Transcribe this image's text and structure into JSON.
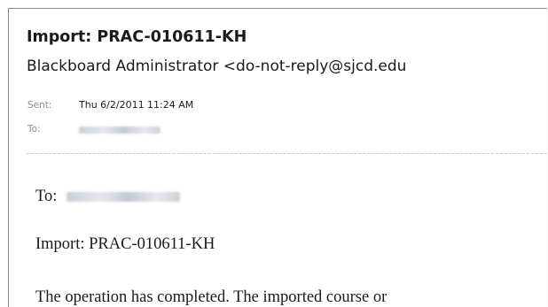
{
  "email": {
    "subject": "Import: PRAC-010611-KH",
    "sender": "Blackboard Administrator <do-not-reply@sjcd.edu",
    "sent_label": "Sent:",
    "sent_value": "Thu 6/2/2011 11:24 AM",
    "to_label": "To:"
  },
  "body": {
    "to_label": "To:",
    "import_line": "Import: PRAC-010611-KH",
    "status_line": "The operation has completed. The imported course or"
  }
}
